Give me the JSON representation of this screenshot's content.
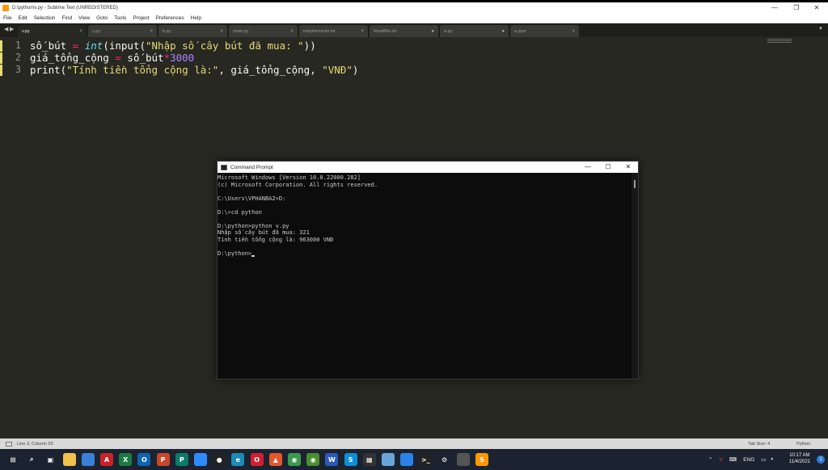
{
  "window": {
    "title": "D:\\python\\v.py - Sublime Text (UNREGISTERED)"
  },
  "menu": [
    "File",
    "Edit",
    "Selection",
    "Find",
    "View",
    "Goto",
    "Tools",
    "Project",
    "Preferences",
    "Help"
  ],
  "tabs": [
    {
      "label": "v.py",
      "active": true,
      "marker": "×"
    },
    {
      "label": "x.py",
      "active": false,
      "marker": "×"
    },
    {
      "label": "b.py",
      "active": false,
      "marker": "×"
    },
    {
      "label": "main.py",
      "active": false,
      "marker": "×"
    },
    {
      "label": "requirements.txt",
      "active": false,
      "marker": "×"
    },
    {
      "label": "ReadMe.txt",
      "active": false,
      "marker": "●"
    },
    {
      "label": "a.py",
      "active": false,
      "marker": "●"
    },
    {
      "label": "a.pyw",
      "active": false,
      "marker": "×"
    }
  ],
  "editor": {
    "line_numbers": [
      "1",
      "2",
      "3"
    ],
    "lines": [
      [
        {
          "t": "số_bút",
          "c": "var"
        },
        {
          "t": " = ",
          "c": "op"
        },
        {
          "t": "int",
          "c": "builtin"
        },
        {
          "t": "(input(",
          "c": "punc"
        },
        {
          "t": "\"Nhập số cây bút đã mua: \"",
          "c": "str"
        },
        {
          "t": "))",
          "c": "punc"
        }
      ],
      [
        {
          "t": "giá_tổng_cộng",
          "c": "var"
        },
        {
          "t": " = ",
          "c": "op"
        },
        {
          "t": "số_bút",
          "c": "var"
        },
        {
          "t": "*",
          "c": "op"
        },
        {
          "t": "3000",
          "c": "num"
        }
      ],
      [
        {
          "t": "print(",
          "c": "punc"
        },
        {
          "t": "\"Tính tiền tổng cộng là:\"",
          "c": "str"
        },
        {
          "t": ", giá_tổng_cộng, ",
          "c": "punc"
        },
        {
          "t": "\"VNĐ\"",
          "c": "str"
        },
        {
          "t": ")",
          "c": "punc"
        }
      ]
    ]
  },
  "statusbar": {
    "position": "Line 3, Column 55",
    "tab_size": "Tab Size: 4",
    "syntax": "Python"
  },
  "cmd": {
    "title": "Command Prompt",
    "lines": [
      "Microsoft Windows [Version 10.0.22000.282]",
      "(c) Microsoft Corporation. All rights reserved.",
      "",
      "C:\\Users\\VPHANBA2>D:",
      "",
      "D:\\>cd python",
      "",
      "D:\\python>python v.py",
      "Nhập số cây bút đã mua: 321",
      "Tính tiền tổng cộng là: 963000 VNĐ",
      "",
      "D:\\python>"
    ]
  },
  "taskbar": {
    "apps": [
      {
        "name": "windows-start-icon",
        "glyph": "⊞",
        "color": "#1c2330"
      },
      {
        "name": "search-icon",
        "glyph": "⌕",
        "color": "#1c2330"
      },
      {
        "name": "task-view-icon",
        "glyph": "▣",
        "color": "#1c2330"
      },
      {
        "name": "file-explorer-icon",
        "glyph": "",
        "color": "#f2c14e"
      },
      {
        "name": "microsoft-store-icon",
        "glyph": "",
        "color": "#3b7fd6"
      },
      {
        "name": "acrobat-icon",
        "glyph": "A",
        "color": "#c8222a"
      },
      {
        "name": "excel-icon",
        "glyph": "X",
        "color": "#1d7a43"
      },
      {
        "name": "outlook-icon",
        "glyph": "O",
        "color": "#0f63b5"
      },
      {
        "name": "powerpoint-icon",
        "glyph": "P",
        "color": "#c8472a"
      },
      {
        "name": "publisher-icon",
        "glyph": "P",
        "color": "#0e7a6b"
      },
      {
        "name": "zoom-icon",
        "glyph": "",
        "color": "#2d8cff"
      },
      {
        "name": "record-icon",
        "glyph": "●",
        "color": "#222"
      },
      {
        "name": "edge-icon",
        "glyph": "e",
        "color": "#1b8cb5"
      },
      {
        "name": "opera-icon",
        "glyph": "O",
        "color": "#d1202f"
      },
      {
        "name": "brave-icon",
        "glyph": "▲",
        "color": "#e2572a"
      },
      {
        "name": "chrome-icon",
        "glyph": "◉",
        "color": "#3a9a4e"
      },
      {
        "name": "chrome-alt-icon",
        "glyph": "◉",
        "color": "#4a8f2f"
      },
      {
        "name": "word-icon",
        "glyph": "W",
        "color": "#2a5bb5"
      },
      {
        "name": "skype-icon",
        "glyph": "S",
        "color": "#0d8fd8"
      },
      {
        "name": "calculator-icon",
        "glyph": "▦",
        "color": "#333"
      },
      {
        "name": "photos-icon",
        "glyph": "",
        "color": "#6aa5d8"
      },
      {
        "name": "messenger-icon",
        "glyph": "",
        "color": "#2a83e8"
      },
      {
        "name": "terminal-icon",
        "glyph": ">_",
        "color": "#222"
      },
      {
        "name": "settings-icon",
        "glyph": "⚙",
        "color": "#1c2330"
      },
      {
        "name": "snipping-tool-icon",
        "glyph": "",
        "color": "#555"
      },
      {
        "name": "sublime-text-icon",
        "glyph": "S",
        "color": "#ff9800"
      }
    ],
    "tray_language": "ENG",
    "time": "10:17 AM",
    "date": "11/4/2021",
    "notification_count": "1"
  }
}
